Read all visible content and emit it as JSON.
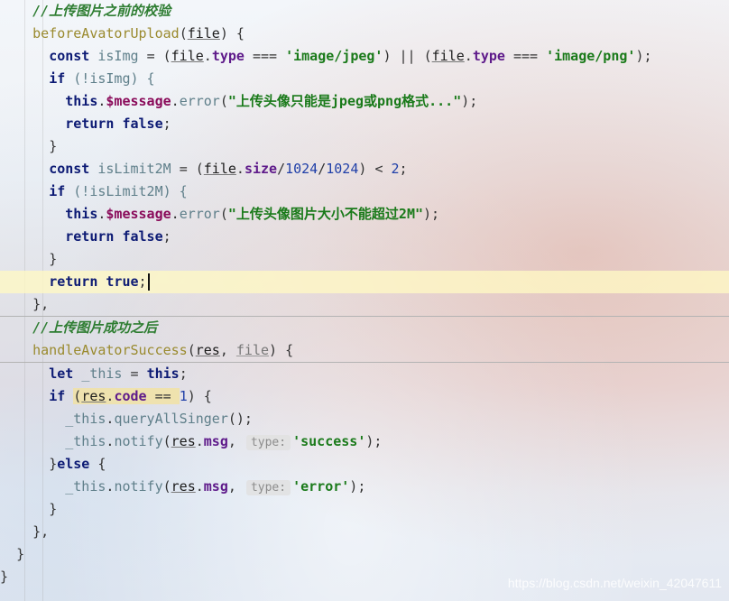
{
  "code": {
    "l1_comment": "//上传图片之前的校验",
    "l2_fn": "beforeAvatorUpload",
    "l2_param": "file",
    "l3_const": "const",
    "l3_var": "isImg",
    "l3_file1": "file",
    "l3_type1": "type",
    "l3_op1": "===",
    "l3_str1": "'image/jpeg'",
    "l3_or": "||",
    "l3_file2": "file",
    "l3_type2": "type",
    "l3_op2": "===",
    "l3_str2": "'image/png'",
    "l4_if": "if",
    "l4_cond": "(!isImg) {",
    "l5_this": "this",
    "l5_message": "$message",
    "l5_error": "error",
    "l5_str": "\"上传头像只能是jpeg或png格式...\"",
    "l6_return": "return",
    "l6_false": "false",
    "l7_brace": "}",
    "l8_const": "const",
    "l8_var": "isLimit2M",
    "l8_file": "file",
    "l8_size": "size",
    "l8_num1": "1024",
    "l8_num2": "1024",
    "l8_lt": "<",
    "l8_num3": "2",
    "l9_if": "if",
    "l9_cond": "(!isLimit2M) {",
    "l10_this": "this",
    "l10_message": "$message",
    "l10_error": "error",
    "l10_str": "\"上传头像图片大小不能超过2M\"",
    "l11_return": "return",
    "l11_false": "false",
    "l12_brace": "}",
    "l13_return": "return",
    "l13_true": "true",
    "l14_close": "},",
    "l15_comment": "//上传图片成功之后",
    "l16_fn": "handleAvatorSuccess",
    "l16_p1": "res",
    "l16_p2": "file",
    "l17_let": "let",
    "l17_var": "_this",
    "l17_this": "this",
    "l18_if": "if",
    "l18_res": "res",
    "l18_code": "code",
    "l18_eq": "==",
    "l18_num": "1",
    "l19_this": "_this",
    "l19_method": "queryAllSinger",
    "l20_this": "_this",
    "l20_method": "notify",
    "l20_res": "res",
    "l20_msg": "msg",
    "l20_hint": "type:",
    "l20_str": "'success'",
    "l21_else": "else",
    "l22_this": "_this",
    "l22_method": "notify",
    "l22_res": "res",
    "l22_msg": "msg",
    "l22_hint": "type:",
    "l22_str": "'error'",
    "l23_brace": "}",
    "l24_close": "},",
    "l25_brace": "}",
    "l26_brace": "}"
  },
  "watermark": "https://blog.csdn.net/weixin_42047611",
  "colors": {
    "comment": "#2e7d32",
    "keyword": "#0c1a74",
    "function": "#9a8a2e",
    "string": "#1a7a1a",
    "property": "#5e1a8a",
    "number": "#1f3fa8",
    "current_line": "#fff8c4"
  }
}
